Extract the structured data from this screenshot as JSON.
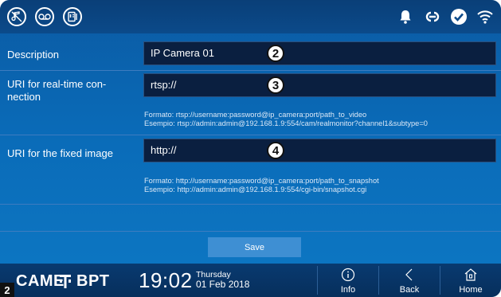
{
  "status_bar": {
    "left_buttons": [
      "mute-icon",
      "voicemail-icon",
      "door-phone-icon"
    ],
    "right_icons": [
      "bell-icon",
      "cloud-link-icon",
      "check-icon",
      "wifi-icon"
    ]
  },
  "form": {
    "rows": [
      {
        "label": "Description",
        "value": "IP Camera 01",
        "badge": "2"
      },
      {
        "label": "URI for real-time con-\nnection",
        "value": "rtsp://",
        "badge": "3",
        "hint_format": "Formato: rtsp://username:password@ip_camera:port/path_to_video",
        "hint_example": "Esempio: rtsp://admin:admin@192.168.1.9:554/cam/realmonitor?channel1&subtype=0"
      },
      {
        "label": "URI for the fixed image",
        "value": "http://",
        "badge": "4",
        "hint_format": "Formato: http://username:password@ip_camera:port/path_to_snapshot",
        "hint_example": "Esempio: http://admin:admin@192.168.1.9:554/cgi-bin/snapshot.cgi"
      }
    ],
    "save_label": "Save"
  },
  "bottom_bar": {
    "brand_left": "CAME",
    "brand_right": "BPT",
    "time": "19:02",
    "day": "Thursday",
    "date": "01 Feb 2018",
    "nav": [
      {
        "label": "Info",
        "icon": "info-icon"
      },
      {
        "label": "Back",
        "icon": "back-chevron-icon"
      },
      {
        "label": "Home",
        "icon": "home-icon"
      }
    ]
  },
  "page_number": "2",
  "colors": {
    "background": "#0a6bb8",
    "field_bg": "#0a1f40",
    "save_button": "#3e8fd3",
    "bar": "#083a70"
  }
}
